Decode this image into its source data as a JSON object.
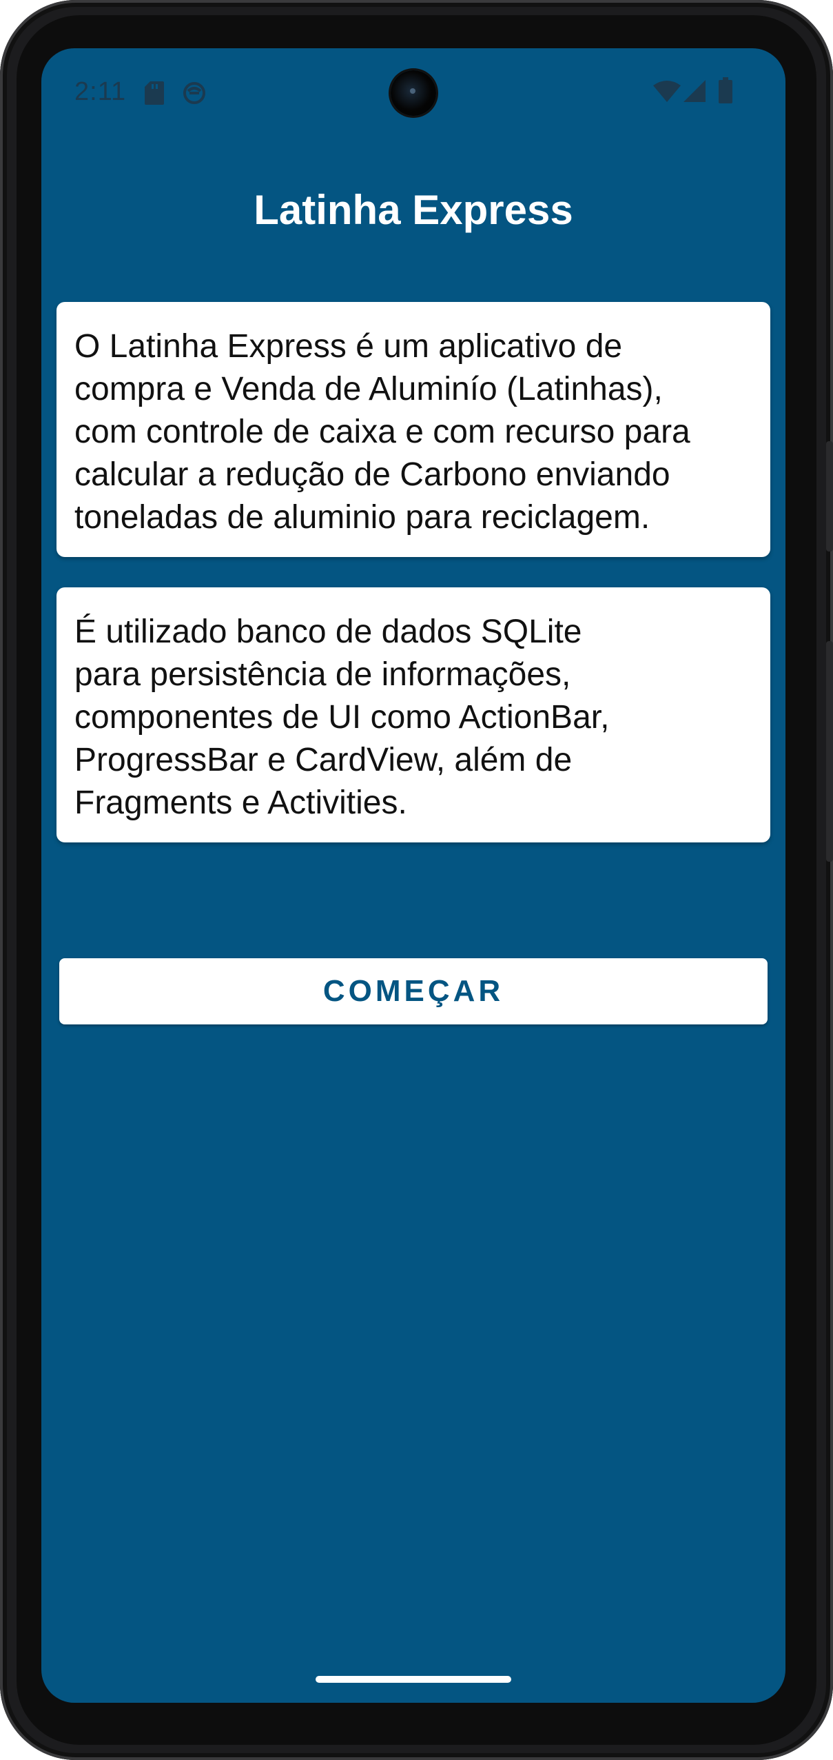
{
  "status_bar": {
    "time": "2:11",
    "icons": [
      "sd-card-icon",
      "app-notification-icon",
      "wifi-icon",
      "signal-icon",
      "battery-icon"
    ]
  },
  "app": {
    "title": "Latinha Express",
    "background_color": "#045582"
  },
  "cards": [
    {
      "text": "O Latinha Express é um aplicativo de\ncompra  e Venda de Aluminío (Latinhas),\ncom controle de caixa e com recurso para\ncalcular a redução de Carbono enviando\ntoneladas de aluminio para reciclagem."
    },
    {
      "text": "É utilizado banco de dados SQLite\npara persistência de informações,\ncomponentes de UI como ActionBar,\nProgressBar e CardView, além de\nFragments e Activities."
    }
  ],
  "start_button": {
    "label": "COMEÇAR",
    "text_color": "#045582"
  }
}
